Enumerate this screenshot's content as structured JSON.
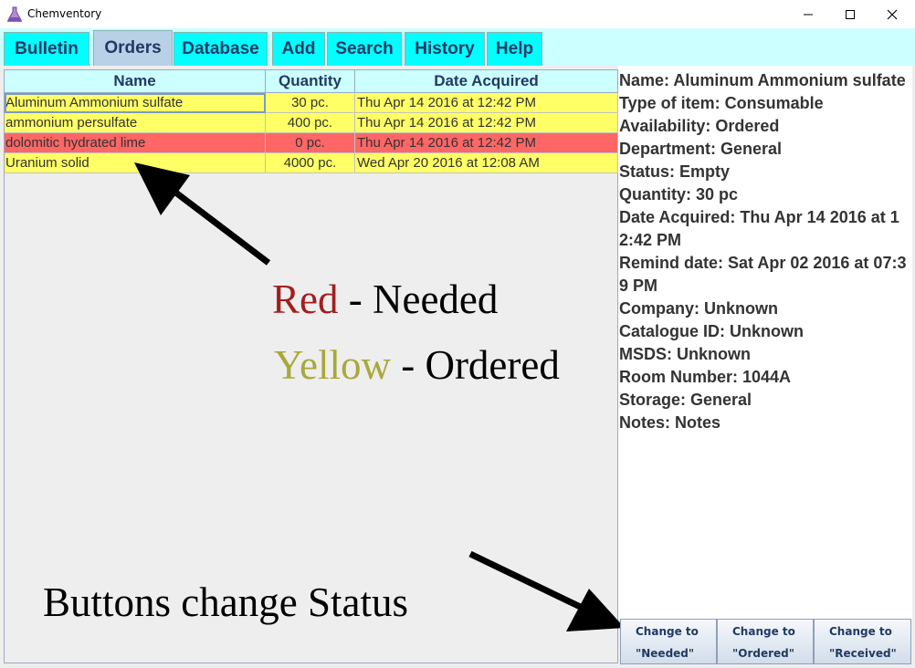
{
  "window": {
    "title": "Chemventory"
  },
  "tabs": [
    {
      "label": "Bulletin"
    },
    {
      "label": "Orders"
    },
    {
      "label": "Database"
    },
    {
      "label": "Add"
    },
    {
      "label": "Search"
    },
    {
      "label": "History"
    },
    {
      "label": "Help"
    }
  ],
  "table": {
    "headers": [
      "Name",
      "Quantity",
      "Date Acquired"
    ],
    "rows": [
      {
        "name": "Aluminum Ammonium sulfate",
        "quantity": "30 pc.",
        "date": "Thu Apr 14 2016 at 12:42 PM",
        "status_color": "#ffff66"
      },
      {
        "name": "ammonium persulfate",
        "quantity": "400 pc.",
        "date": "Thu Apr 14 2016 at 12:42 PM",
        "status_color": "#ffff66"
      },
      {
        "name": "dolomitic hydrated lime",
        "quantity": "0 pc.",
        "date": "Thu Apr 14 2016 at 12:42 PM",
        "status_color": "#ff6666"
      },
      {
        "name": "Uranium solid",
        "quantity": "4000 pc.",
        "date": "Wed Apr 20 2016 at 12:08 AM",
        "status_color": "#ffff66"
      }
    ]
  },
  "details": [
    "Name: Aluminum Ammonium sulfate",
    "Type of item: Consumable",
    "Availability: Ordered",
    "Department: General",
    "Status: Empty",
    "Quantity: 30 pc",
    "Date Acquired: Thu Apr 14 2016 at 12:42 PM",
    "Remind date: Sat Apr 02 2016 at 07:39 PM",
    "Company: Unknown",
    "Catalogue ID: Unknown",
    "MSDS: Unknown",
    "Room Number: 1044A",
    "Storage: General",
    "Notes: Notes"
  ],
  "buttons": [
    {
      "line1": "Change to",
      "line2": "\"Needed\""
    },
    {
      "line1": "Change to",
      "line2": "\"Ordered\""
    },
    {
      "line1": "Change to",
      "line2": "\"Received\""
    }
  ],
  "annotations": {
    "red_word": "Red",
    "red_rest": " - Needed",
    "yellow_word": "Yellow",
    "yellow_rest": " - Ordered",
    "buttons_note": "Buttons change Status"
  },
  "colors": {
    "needed": "#ff6666",
    "ordered": "#ffff66",
    "tab": "#00ffff",
    "tab_selected": "#b9d1e6"
  },
  "icons": {
    "app": "flask-icon",
    "minimize": "minimize-icon",
    "maximize": "maximize-icon",
    "close": "close-icon"
  }
}
